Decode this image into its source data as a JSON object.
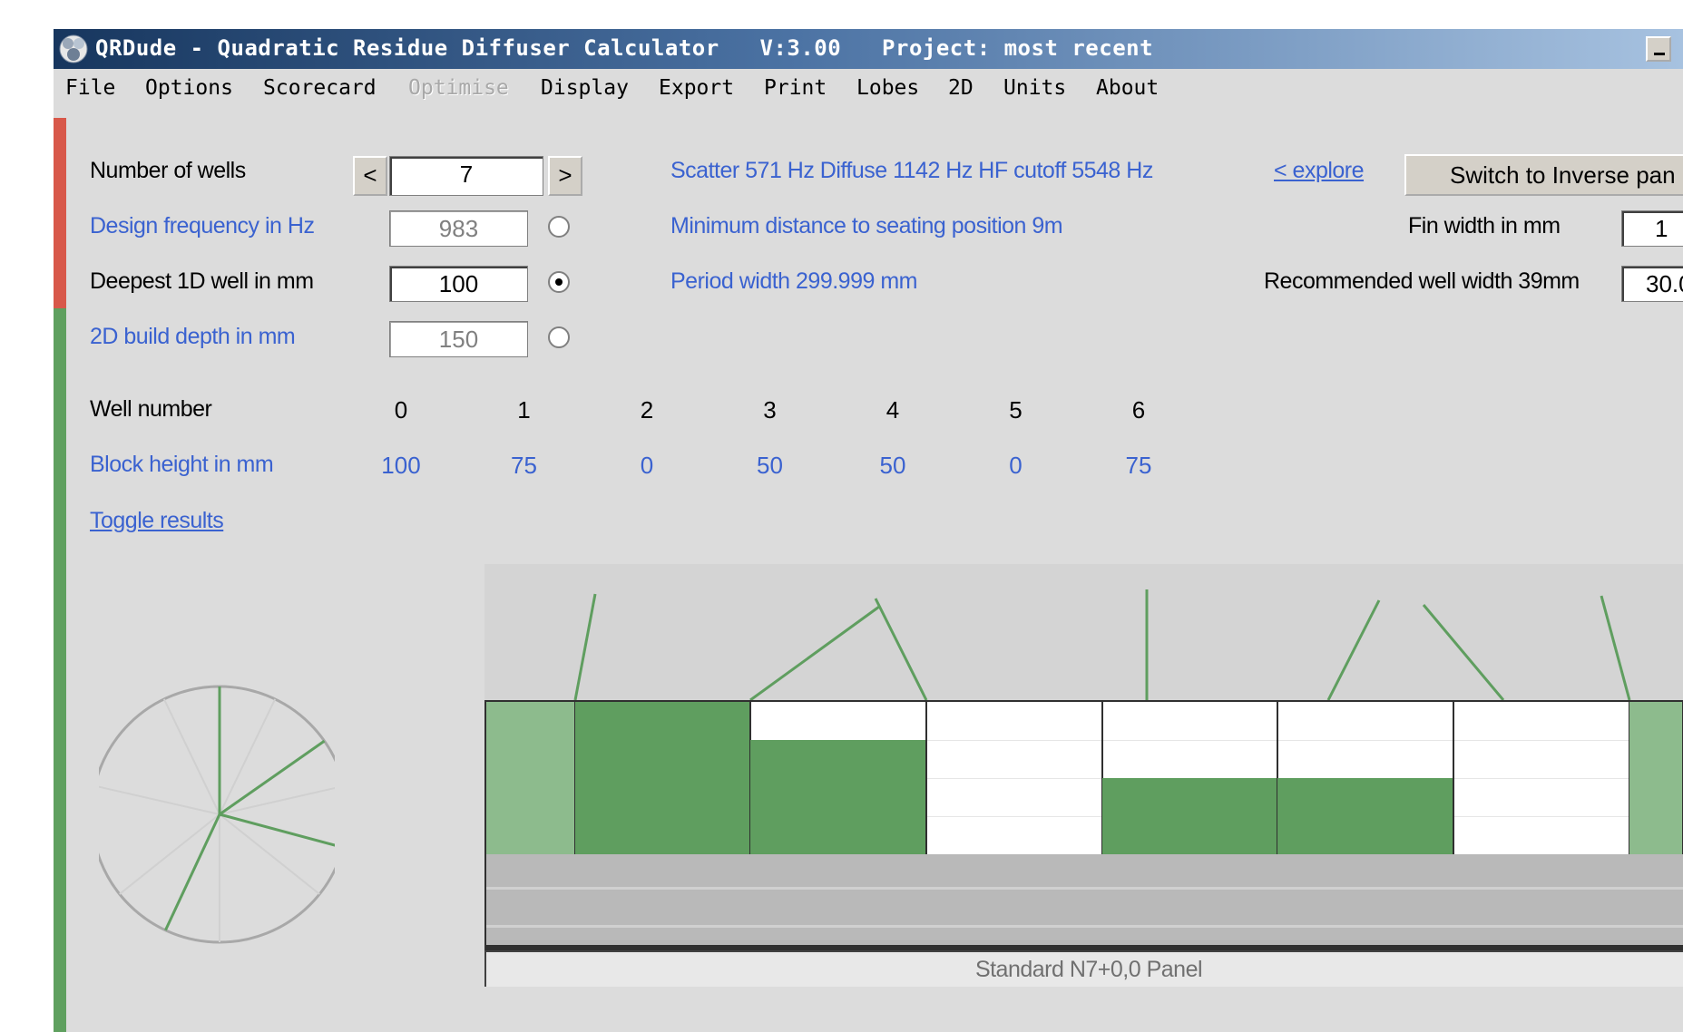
{
  "window": {
    "title": "QRDude - Quadratic Residue Diffuser Calculator   V:3.00   Project: most recent"
  },
  "menu": [
    {
      "label": "File",
      "enabled": true
    },
    {
      "label": "Options",
      "enabled": true
    },
    {
      "label": "Scorecard",
      "enabled": true
    },
    {
      "label": "Optimise",
      "enabled": false
    },
    {
      "label": "Display",
      "enabled": true
    },
    {
      "label": "Export",
      "enabled": true
    },
    {
      "label": "Print",
      "enabled": true
    },
    {
      "label": "Lobes",
      "enabled": true
    },
    {
      "label": "2D",
      "enabled": true
    },
    {
      "label": "Units",
      "enabled": true
    },
    {
      "label": "About",
      "enabled": true
    }
  ],
  "form": {
    "wells_label": "Number of wells",
    "wells_value": "7",
    "wells_prev": "<",
    "wells_next": ">",
    "design_freq_label": "Design frequency in Hz",
    "design_freq_value": "983",
    "deepest_label": "Deepest 1D well in mm",
    "deepest_value": "100",
    "build_depth_label": "2D build depth in mm",
    "build_depth_value": "150",
    "selected_radio": "deepest"
  },
  "info": {
    "frequencies": "Scatter 571 Hz  Diffuse 1142 Hz  HF cutoff 5548 Hz",
    "explore_link": "< explore",
    "min_distance": "Minimum distance to seating position  9m",
    "period_width": "Period width  299.999 mm",
    "switch_button": "Switch to Inverse pan",
    "fin_width_label": "Fin width in mm",
    "fin_width_value": "1",
    "rec_width_label": "Recommended well width  39mm",
    "rec_width_value": "30.0"
  },
  "wells": {
    "number_label": "Well number",
    "height_label": "Block height in mm",
    "numbers": [
      "0",
      "1",
      "2",
      "3",
      "4",
      "5",
      "6"
    ],
    "heights": [
      "100",
      "75",
      "0",
      "50",
      "50",
      "0",
      "75"
    ]
  },
  "toggle_link": "Toggle results",
  "panel_label": "Standard N7+0,0 Panel",
  "colors": {
    "title_gradient_start": "#17365e",
    "title_gradient_end": "#a7c2e0",
    "accent_blue": "#3a62d0",
    "block_green": "#5f9e5f",
    "light_green": "#8dbb8d",
    "stripe_red": "#d8584a",
    "stripe_green": "#5fa05f"
  }
}
